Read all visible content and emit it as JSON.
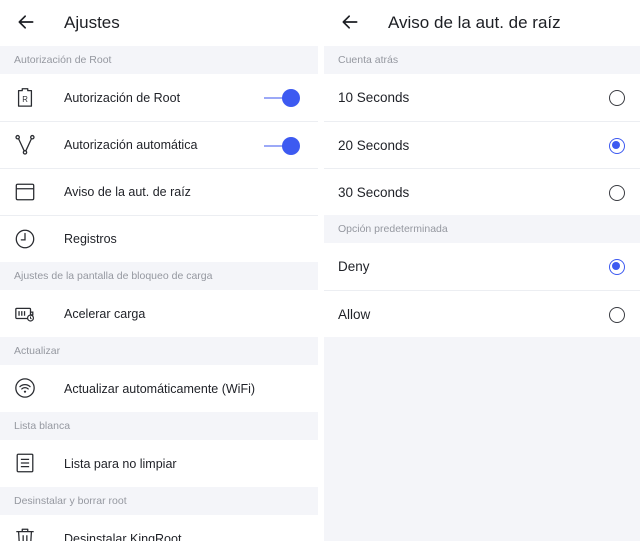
{
  "left": {
    "title": "Ajustes",
    "back_icon": "arrow-left-icon",
    "sections": [
      {
        "header": "Autorización de Root",
        "items": [
          {
            "label": "Autorización de Root",
            "icon": "root-badge-icon",
            "toggle": true
          },
          {
            "label": "Autorización automática",
            "icon": "branch-icon",
            "toggle": true
          },
          {
            "label": "Aviso de la aut. de raíz",
            "icon": "window-icon"
          },
          {
            "label": "Registros",
            "icon": "clock-icon"
          }
        ]
      },
      {
        "header": "Ajustes de la pantalla de bloqueo de carga",
        "items": [
          {
            "label": "Acelerar carga",
            "icon": "charging-icon"
          }
        ]
      },
      {
        "header": "Actualizar",
        "items": [
          {
            "label": "Actualizar automáticamente (WiFi)",
            "icon": "wifi-icon"
          }
        ]
      },
      {
        "header": "Lista blanca",
        "items": [
          {
            "label": "Lista para no limpiar",
            "icon": "list-icon"
          }
        ]
      },
      {
        "header": "Desinstalar y borrar root",
        "items": [
          {
            "label": "Desinstalar KingRoot",
            "icon": "trash-icon"
          }
        ]
      }
    ]
  },
  "right": {
    "title": "Aviso de la aut. de raíz",
    "back_icon": "arrow-left-icon",
    "countdown": {
      "header": "Cuenta atrás",
      "options": [
        {
          "label": "10 Seconds",
          "checked": false
        },
        {
          "label": "20 Seconds",
          "checked": true
        },
        {
          "label": "30 Seconds",
          "checked": false
        }
      ]
    },
    "default_option": {
      "header": "Opción predeterminada",
      "options": [
        {
          "label": "Deny",
          "checked": true
        },
        {
          "label": "Allow",
          "checked": false
        }
      ]
    }
  },
  "colors": {
    "accent": "#3d5af1",
    "background": "#f4f5f9",
    "text": "#1f2127",
    "section_text": "#9598a0"
  }
}
